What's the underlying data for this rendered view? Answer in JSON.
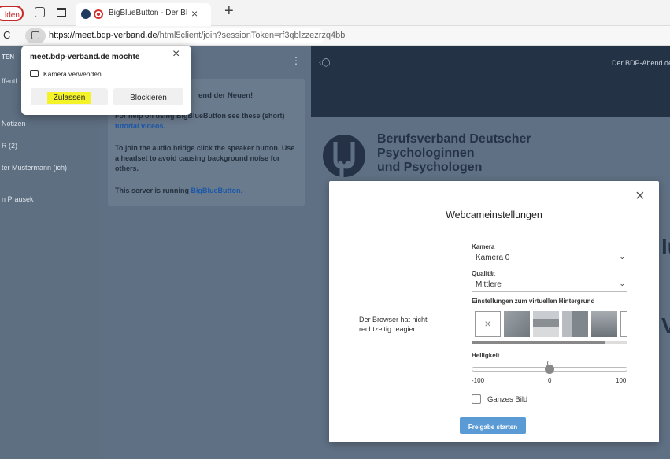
{
  "browser": {
    "tab_left_label": "lden",
    "tab_title": "BigBlueButton - Der BDP-Ab",
    "tab_close": "×",
    "new_tab": "+",
    "reload": "C",
    "url_host": "https://meet.bdp-verband.de",
    "url_path": "/html5client/join?sessionToken=rf3qblzzezrzq4bb"
  },
  "sidebar": {
    "header": "TEN",
    "items": [
      "ffentl",
      "Notizen",
      "R (2)",
      "ter Mustermann (ich)",
      "n Prausek"
    ]
  },
  "chat": {
    "title_fragment": "end der Neuen!",
    "line1": "For help on using BigBlueButton see these (short)",
    "line1_link": "tutorial videos.",
    "line2": "To join the audio bridge click the speaker button. Use a headset to avoid causing background noise for others.",
    "line3_pre": "This server is running ",
    "line3_link": "BigBlueButton.",
    "more_icon": "⋮"
  },
  "topbar": {
    "title": "Der BDP-Abend de"
  },
  "presentation": {
    "org_line1": "Berufsverband Deutscher",
    "org_line2": "Psychologinnen",
    "org_line3": "und Psychologen",
    "edge_chars": [
      "lu",
      "V"
    ]
  },
  "permission": {
    "site": "meet.bdp-verband.de möchte",
    "request": "Kamera verwenden",
    "allow": "Zulassen",
    "block": "Blockieren",
    "close": "×"
  },
  "webcam_modal": {
    "title": "Webcameinstellungen",
    "close": "×",
    "message": "Der Browser hat nicht rechtzeitig reagiert.",
    "camera_label": "Kamera",
    "camera_value": "Kamera 0",
    "quality_label": "Qualität",
    "quality_value": "Mittlere",
    "bg_label": "Einstellungen zum virtuellen Hintergrund",
    "brightness_label": "Helligkeit",
    "slider_value": "0",
    "slider_min": "-100",
    "slider_mid": "0",
    "slider_max": "100",
    "slider_level": 0.5,
    "whole_image": "Ganzes Bild",
    "start": "Freigabe starten"
  }
}
